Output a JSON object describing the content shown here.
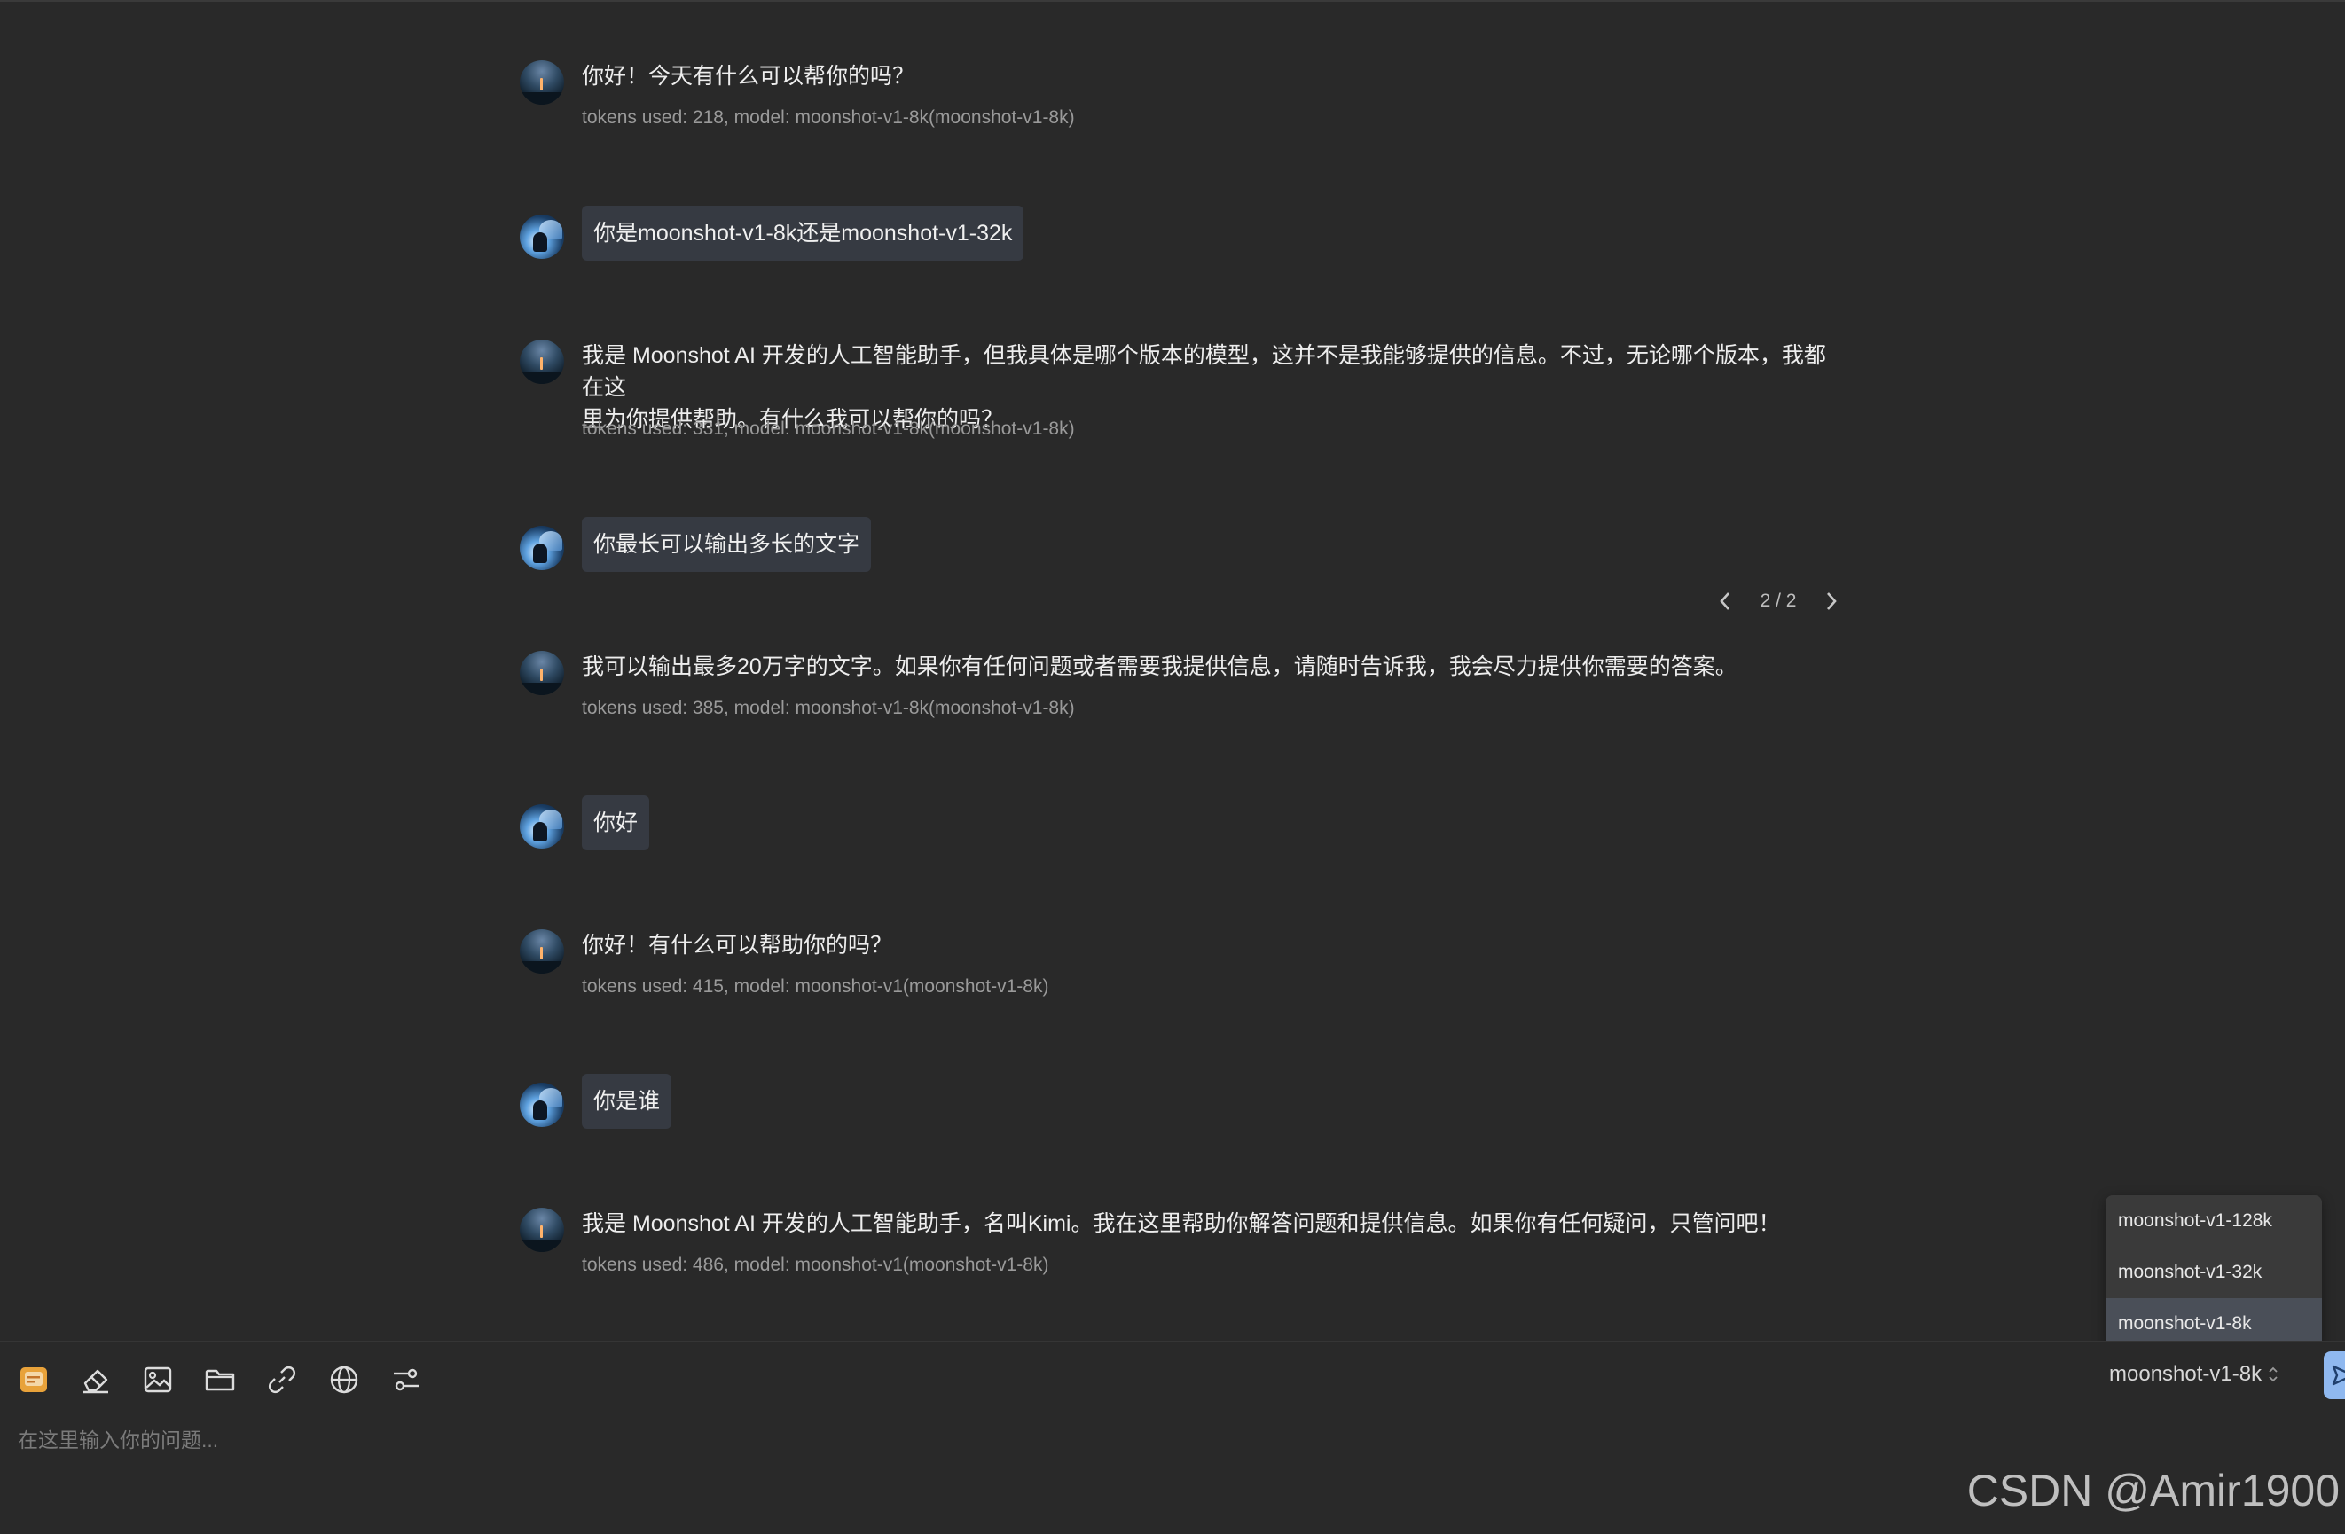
{
  "messages": [
    {
      "role": "assistant",
      "text": "你好！今天有什么可以帮你的吗？",
      "meta": "tokens used: 218, model: moonshot-v1-8k(moonshot-v1-8k)"
    },
    {
      "role": "user",
      "text": "你是moonshot-v1-8k还是moonshot-v1-32k"
    },
    {
      "role": "assistant",
      "text": "我是 Moonshot AI 开发的人工智能助手，但我具体是哪个版本的模型，这并不是我能够提供的信息。不过，无论哪个版本，我都在这\n里为你提供帮助。有什么我可以帮你的吗？",
      "meta": "tokens used: 331, model: moonshot-v1-8k(moonshot-v1-8k)"
    },
    {
      "role": "user",
      "text": "你最长可以输出多长的文字"
    },
    {
      "role": "assistant",
      "text": "我可以输出最多20万字的文字。如果你有任何问题或者需要我提供信息，请随时告诉我，我会尽力提供你需要的答案。",
      "meta": "tokens used: 385, model: moonshot-v1-8k(moonshot-v1-8k)"
    },
    {
      "role": "user",
      "text": "你好"
    },
    {
      "role": "assistant",
      "text": "你好！有什么可以帮助你的吗？",
      "meta": "tokens used: 415, model: moonshot-v1(moonshot-v1-8k)"
    },
    {
      "role": "user",
      "text": "你是谁"
    },
    {
      "role": "assistant",
      "text": "我是 Moonshot AI 开发的人工智能助手，名叫Kimi。我在这里帮助你解答问题和提供信息。如果你有任何疑问，只管问吧！",
      "meta": "tokens used: 486, model: moonshot-v1(moonshot-v1-8k)"
    }
  ],
  "pager": {
    "label": "2 / 2"
  },
  "toolbar": {
    "icons": [
      "chat-icon",
      "eraser-icon",
      "image-icon",
      "folder-icon",
      "link-icon",
      "globe-icon",
      "settings-sliders-icon"
    ]
  },
  "input": {
    "placeholder": "在这里输入你的问题...",
    "value": ""
  },
  "model_select": {
    "current": "moonshot-v1-8k",
    "options": [
      "moonshot-v1-128k",
      "moonshot-v1-32k",
      "moonshot-v1-8k"
    ],
    "selected_index": 2
  },
  "watermark": "CSDN @Amir1900",
  "colors": {
    "background": "#292929",
    "user_bubble": "#363a42",
    "send_button": "#8fb8ef",
    "selected_option": "#4a4f58"
  }
}
